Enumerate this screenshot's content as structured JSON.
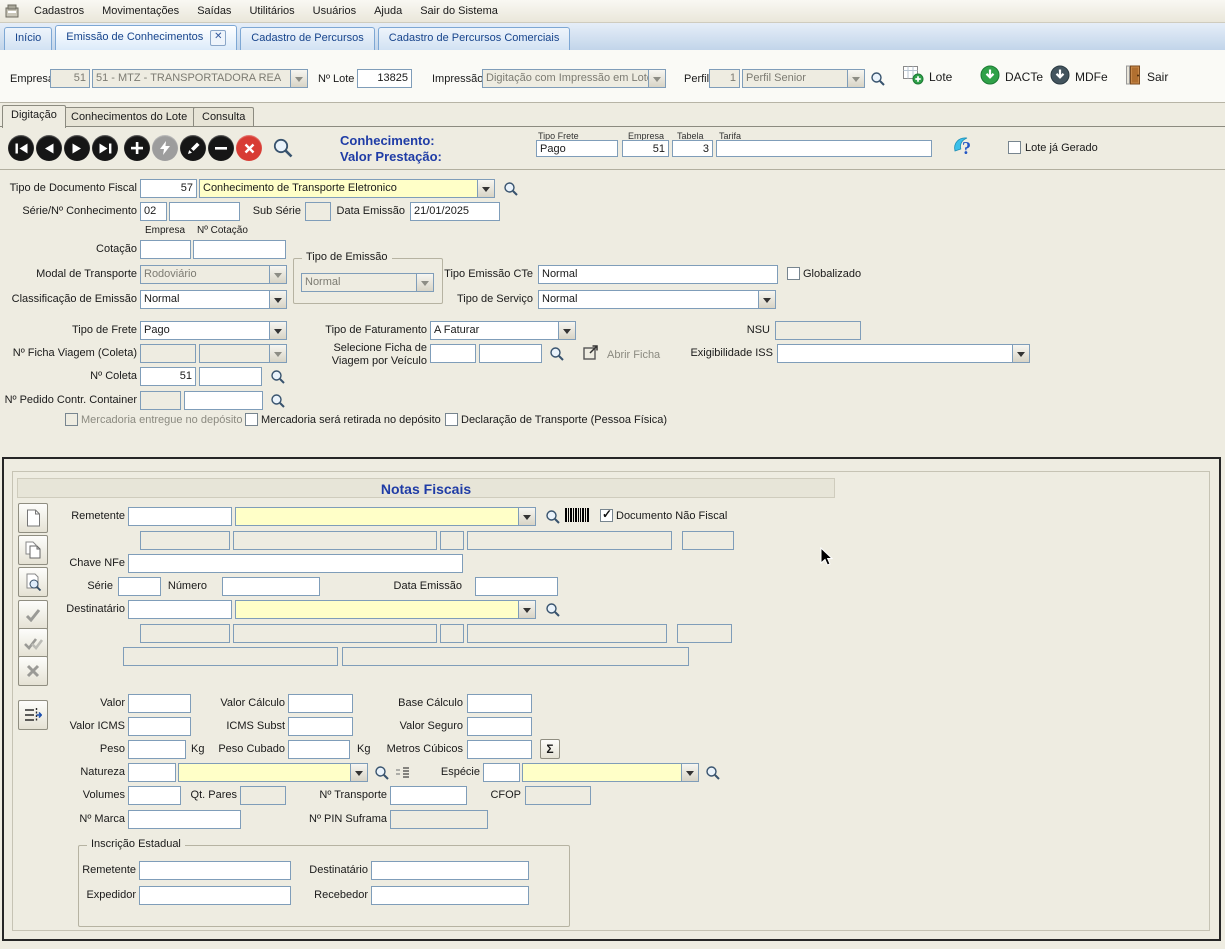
{
  "menubar": {
    "items": [
      "Cadastros",
      "Movimentações",
      "Saídas",
      "Utilitários",
      "Usuários",
      "Ajuda",
      "Sair do Sistema"
    ]
  },
  "tabs": {
    "items": [
      {
        "label": "Início"
      },
      {
        "label": "Emissão de Conhecimentos"
      },
      {
        "label": "Cadastro de Percursos"
      },
      {
        "label": "Cadastro de Percursos Comerciais"
      }
    ]
  },
  "header": {
    "empresa_label": "Empresa",
    "empresa_code": "51",
    "empresa_name": "51 - MTZ - TRANSPORTADORA REA",
    "lote_label": "Nº Lote",
    "lote_value": "13825",
    "impressao_label": "Impressão",
    "impressao_value": "Digitação com Impressão em Lote",
    "perfil_label": "Perfil",
    "perfil_code": "1",
    "perfil_name": "Perfil Senior",
    "btn_lote": "Lote",
    "btn_dacte": "DACTe",
    "btn_mdfe": "MDFe",
    "btn_sair": "Sair"
  },
  "subtabs": {
    "digitacao": "Digitação",
    "conhecimentos": "Conhecimentos do Lote",
    "consulta": "Consulta"
  },
  "recordbar": {
    "conhecimento": "Conhecimento:",
    "valor_prestacao": "Valor Prestação:",
    "tipo_frete_label": "Tipo Frete",
    "tipo_frete": "Pago",
    "empresa_label": "Empresa",
    "empresa": "51",
    "tabela_label": "Tabela",
    "tabela": "3",
    "tarifa_label": "Tarifa",
    "lote_gerado": "Lote já Gerado"
  },
  "form": {
    "tipo_doc_label": "Tipo de Documento Fiscal",
    "tipo_doc_code": "57",
    "tipo_doc_desc": "Conhecimento de Transporte Eletronico",
    "serie_label": "Série/Nº Conhecimento",
    "serie": "02",
    "sub_serie_label": "Sub Série",
    "data_emissao_label": "Data Emissão",
    "data_emissao": "21/01/2025",
    "empresa_col": "Empresa",
    "cotacao_col": "Nº Cotação",
    "cotacao_label": "Cotação",
    "modal_label": "Modal de Transporte",
    "modal": "Rodoviário",
    "tipo_emissao_group": "Tipo de Emissão",
    "tipo_emissao": "Normal",
    "tipo_emissao_cte_label": "Tipo Emissão CTe",
    "tipo_emissao_cte": "Normal",
    "globalizado": "Globalizado",
    "classificacao_label": "Classificação de Emissão",
    "classificacao": "Normal",
    "tipo_servico_label": "Tipo de Serviço",
    "tipo_servico": "Normal",
    "tipo_frete_label": "Tipo de Frete",
    "tipo_frete": "Pago",
    "tipo_faturamento_label": "Tipo de Faturamento",
    "tipo_faturamento": "A Faturar",
    "nsu_label": "NSU",
    "ficha_viagem_label": "Nº Ficha Viagem (Coleta)",
    "selecione_ficha_label": "Selecione Ficha de Viagem por Veículo",
    "abrir_ficha": "Abrir Ficha",
    "exigibilidade_label": "Exigibilidade ISS",
    "coleta_label": "Nº Coleta",
    "coleta_empresa": "51",
    "pedido_label": "Nº Pedido Contr. Container",
    "chk_entregue": "Mercadoria entregue no depósito",
    "chk_retirada": "Mercadoria será retirada no depósito",
    "chk_declaracao": "Declaração de Transporte (Pessoa Física)"
  },
  "notas": {
    "title": "Notas Fiscais",
    "remetente_label": "Remetente",
    "doc_nao_fiscal": "Documento Não Fiscal",
    "chave_label": "Chave NFe",
    "serie_label": "Série",
    "numero_label": "Número",
    "data_emissao_label": "Data Emissão",
    "destinatario_label": "Destinatário",
    "valor_label": "Valor",
    "valor_calculo_label": "Valor Cálculo",
    "base_calculo_label": "Base Cálculo",
    "valor_icms_label": "Valor ICMS",
    "icms_subst_label": "ICMS Subst",
    "valor_seguro_label": "Valor Seguro",
    "peso_label": "Peso",
    "kg": "Kg",
    "peso_cubado_label": "Peso Cubado",
    "metros_cubicos_label": "Metros Cúbicos",
    "natureza_label": "Natureza",
    "especie_label": "Espécie",
    "volumes_label": "Volumes",
    "qt_pares_label": "Qt. Pares",
    "transporte_label": "Nº Transporte",
    "cfop_label": "CFOP",
    "marca_label": "Nº Marca",
    "pin_label": "Nº PIN Suframa",
    "ie_group": "Inscrição Estadual",
    "ie_remetente_label": "Remetente",
    "ie_destinatario_label": "Destinatário",
    "ie_expedidor_label": "Expedidor",
    "ie_recebedor_label": "Recebedor"
  },
  "colors": {
    "accent_blue": "#1f3ca6",
    "field_yellow": "#ffffc8",
    "tab_blue": "#17448c",
    "cancel_red": "#d83c34"
  }
}
